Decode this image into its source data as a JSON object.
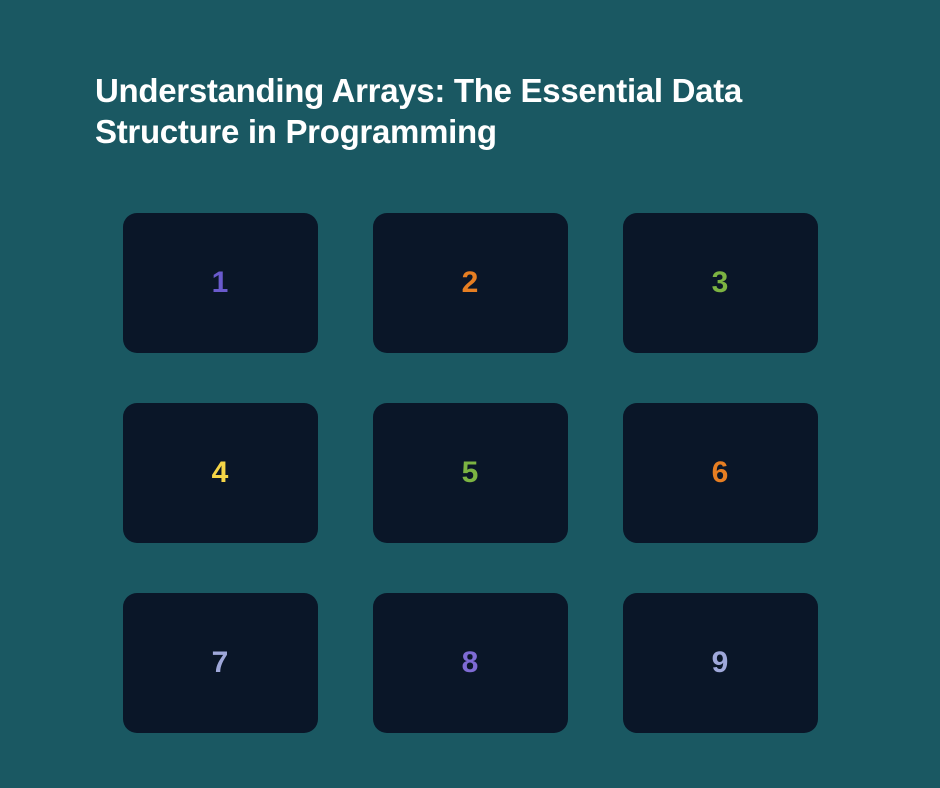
{
  "title": "Understanding Arrays: The Essential Data Structure in Programming",
  "cells": [
    {
      "value": "1",
      "color": "#6a5acd"
    },
    {
      "value": "2",
      "color": "#e67e22"
    },
    {
      "value": "3",
      "color": "#7cb342"
    },
    {
      "value": "4",
      "color": "#f5d547"
    },
    {
      "value": "5",
      "color": "#7cb342"
    },
    {
      "value": "6",
      "color": "#e67e22"
    },
    {
      "value": "7",
      "color": "#9fa8da"
    },
    {
      "value": "8",
      "color": "#7e6bd4"
    },
    {
      "value": "9",
      "color": "#9fa8da"
    }
  ]
}
